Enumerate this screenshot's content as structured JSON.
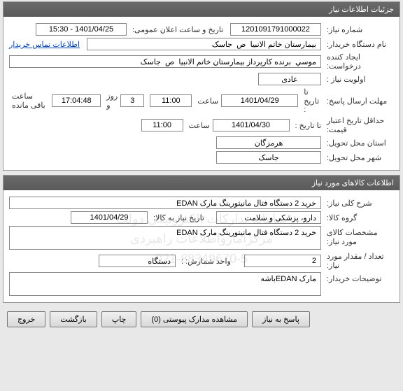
{
  "panel1": {
    "title": "جزئیات اطلاعات نیاز",
    "need_no_label": "شماره نیاز:",
    "need_no": "1201091791000022",
    "pub_date_label": "تاریخ و ساعت اعلان عمومی:",
    "pub_date": "1401/04/25 - 15:30",
    "buyer_label": "نام دستگاه خریدار:",
    "buyer": "بیمارستان خاتم الانبیا  ص  جاسک",
    "contact_link": "اطلاعات تماس خریدار",
    "creator_label": "ایجاد کننده درخواست:",
    "creator": "موسي  برنده کارپرداز بیمارستان خاتم الانبیا  ص  جاسک",
    "priority_label": "اولویت نیاز :",
    "priority": "عادی",
    "deadline_label": "مهلت ارسال پاسخ:",
    "to_date_label": "تا تاریخ :",
    "deadline_date": "1401/04/29",
    "time_label": "ساعت",
    "deadline_time": "11:00",
    "days_remain": "3",
    "days_label": "روز و",
    "hours_remain": "17:04:48",
    "hours_label": "ساعت باقی مانده",
    "min_valid_label": "حداقل تاریخ اعتبار قیمت:",
    "min_valid_date": "1401/04/30",
    "min_valid_time": "11:00",
    "province_label": "استان محل تحویل:",
    "province": "هرمزگان",
    "city_label": "شهر محل تحویل:",
    "city": "جاسک"
  },
  "panel2": {
    "title": "اطلاعات کالاهای مورد نیاز",
    "desc_label": "شرح کلی نیاز:",
    "desc": "خرید 2 دستگاه فتال مانیتورینگ مارک EDAN",
    "group_label": "گروه کالا:",
    "group": "دارو، پزشکی و سلامت",
    "need_date_label": "تاریخ نیاز به کالا:",
    "need_date": "1401/04/29",
    "spec_label": "مشخصات کالای مورد نیاز:",
    "spec": "خرید 2 دستگاه فتال مانیتورینگ مارک EDAN",
    "qty_label": "تعداد / مقدار مورد نیاز:",
    "qty": "2",
    "unit_label": "واحد شمارش:   :",
    "unit": "دستگاه",
    "notes_label": "توضیحات خریدار:",
    "notes": "مارک EDANباشه"
  },
  "buttons": {
    "reply": "پاسخ به نیاز",
    "attach": "مشاهده مدارک پیوستی (0)",
    "print": "چاپ",
    "back": "بازگشت",
    "exit": "خروج"
  },
  "watermark": {
    "line1": "سامانه تدارکات الکترونیکی دولت",
    "line2": "مرکزآمارواطلاعات راهبردی",
    "line3": "021-88349670-5"
  }
}
